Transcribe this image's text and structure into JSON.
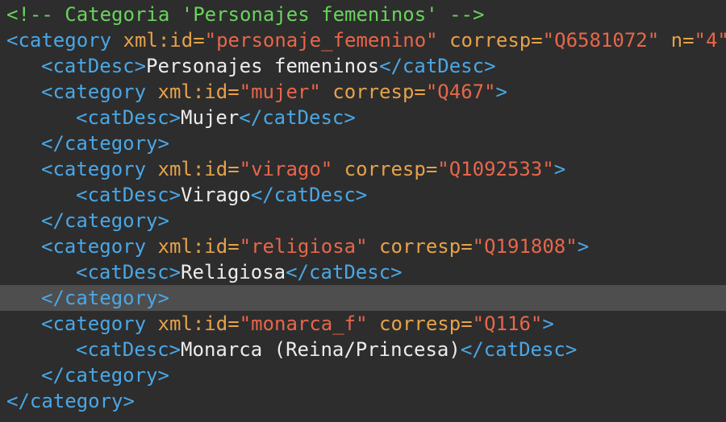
{
  "colors": {
    "background": "#2d2d2d",
    "current_line": "#4e4e4e",
    "comment": "#6ad35d",
    "tag": "#4aa7e6",
    "attribute": "#e6a24a",
    "value": "#e8664a",
    "text": "#ececec"
  },
  "lines": [
    {
      "comment": "<!-- Categoria 'Personajes femeninos' -->"
    },
    {
      "open": "<category",
      "a1": " xml:id=",
      "v1": "\"personaje_femenino\"",
      "a2": " corresp=",
      "v2": "\"Q6581072\"",
      "a3": " n=",
      "v3": "\"4\"",
      "close": ">"
    },
    {
      "open": "<catDesc>",
      "text": "Personajes femeninos",
      "close": "</catDesc>"
    },
    {
      "open": "<category",
      "a1": " xml:id=",
      "v1": "\"mujer\"",
      "a2": " corresp=",
      "v2": "\"Q467\"",
      "close": ">"
    },
    {
      "open": "<catDesc>",
      "text": "Mujer",
      "close": "</catDesc>"
    },
    {
      "close": "</category>"
    },
    {
      "open": "<category",
      "a1": " xml:id=",
      "v1": "\"virago\"",
      "a2": " corresp=",
      "v2": "\"Q1092533\"",
      "close": ">"
    },
    {
      "open": "<catDesc>",
      "text": "Virago",
      "close": "</catDesc>"
    },
    {
      "close": "</category>"
    },
    {
      "open": "<category",
      "a1": " xml:id=",
      "v1": "\"religiosa\"",
      "a2": " corresp=",
      "v2": "\"Q191808\"",
      "close": ">"
    },
    {
      "open": "<catDesc>",
      "text": "Religiosa",
      "close": "</catDesc>"
    },
    {
      "close": "</category>"
    },
    {
      "open": "<category",
      "a1": " xml:id=",
      "v1": "\"monarca_f\"",
      "a2": " corresp=",
      "v2": "\"Q116\"",
      "close": ">"
    },
    {
      "open": "<catDesc>",
      "text": "Monarca (Reina/Princesa)",
      "close": "</catDesc>"
    },
    {
      "close": "</category>"
    },
    {
      "close": "</category>"
    }
  ]
}
